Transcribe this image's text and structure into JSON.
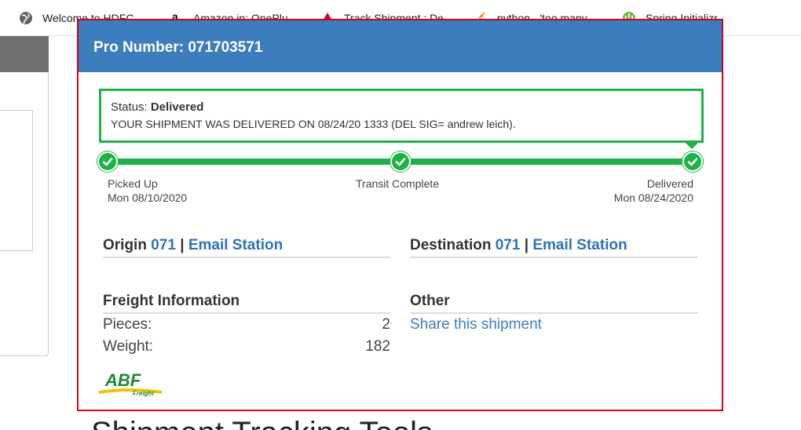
{
  "bookmarks": [
    {
      "label": "Welcome to HDFC...",
      "icon": "globe-icon"
    },
    {
      "label": "Amazon.in: OnePlu...",
      "icon": "amazon-icon"
    },
    {
      "label": "Track Shipment : De...",
      "icon": "delta-icon"
    },
    {
      "label": "python - 'too many...",
      "icon": "stackoverflow-icon"
    },
    {
      "label": "Spring Initializr",
      "icon": "spring-icon"
    }
  ],
  "background": {
    "heading": "Shipment Tracking Tools"
  },
  "card": {
    "pro_number_label": "Pro Number: 071703571",
    "status_label": "Status:",
    "status_value": "Delivered",
    "status_message": "YOUR SHIPMENT WAS DELIVERED ON 08/24/20 1333 (DEL SIG= andrew leich).",
    "steps": [
      {
        "label": "Picked Up",
        "date": "Mon 08/10/2020"
      },
      {
        "label": "Transit Complete",
        "date": ""
      },
      {
        "label": "Delivered",
        "date": "Mon 08/24/2020"
      }
    ],
    "origin": {
      "title": "Origin",
      "code": "071",
      "separator": "|",
      "link": "Email Station"
    },
    "destination": {
      "title": "Destination",
      "code": "071",
      "separator": "|",
      "link": "Email Station"
    },
    "freight": {
      "title": "Freight Information",
      "rows": [
        {
          "label": "Pieces:",
          "value": "2"
        },
        {
          "label": "Weight:",
          "value": "182"
        }
      ]
    },
    "other": {
      "title": "Other",
      "share_link": "Share this shipment"
    },
    "logo": {
      "brand": "ABF",
      "sub": "Freight"
    }
  },
  "colors": {
    "header_blue": "#3b7dbd",
    "progress_green": "#1db347",
    "link_blue": "#2f73b6",
    "frame_red": "#d9001b"
  }
}
